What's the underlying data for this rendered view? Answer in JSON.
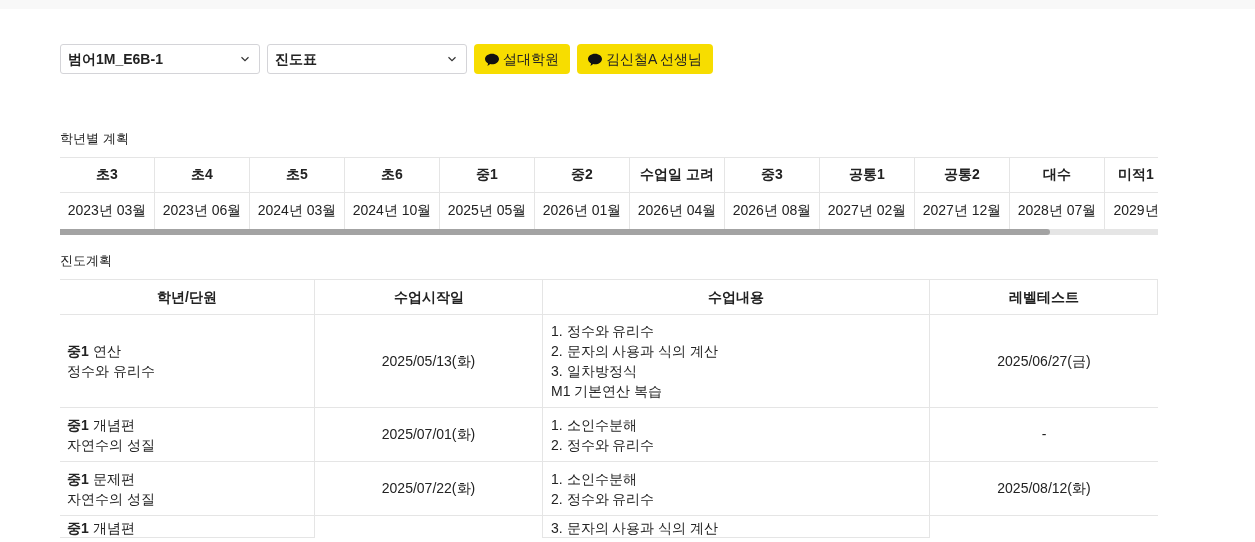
{
  "selects": [
    {
      "value": "범어1M_E6B-1"
    },
    {
      "value": "진도표"
    }
  ],
  "chat_buttons": [
    {
      "label": "설대학원"
    },
    {
      "label": "김신철A 선생님"
    }
  ],
  "grade_plan": {
    "title": "학년별 계획",
    "columns": [
      {
        "grade": "초3",
        "date": "2023년 03월"
      },
      {
        "grade": "초4",
        "date": "2023년 06월"
      },
      {
        "grade": "초5",
        "date": "2024년 03월"
      },
      {
        "grade": "초6",
        "date": "2024년 10월"
      },
      {
        "grade": "중1",
        "date": "2025년 05월"
      },
      {
        "grade": "중2",
        "date": "2026년 01월"
      },
      {
        "grade": "수업일 고려",
        "date": "2026년 04월"
      },
      {
        "grade": "중3",
        "date": "2026년 08월"
      },
      {
        "grade": "공통1",
        "date": "2027년 02월"
      },
      {
        "grade": "공통2",
        "date": "2027년 12월"
      },
      {
        "grade": "대수",
        "date": "2028년 07월"
      },
      {
        "grade": "미적1",
        "date": "2029년"
      }
    ]
  },
  "progress_plan": {
    "title": "진도계획",
    "columns": [
      "학년/단원",
      "수업시작일",
      "수업내용",
      "레벨테스트"
    ],
    "rows": [
      {
        "unit": "**중1** 연산",
        "topic": "정수와 유리수",
        "start": "2025/05/13(화)",
        "contents": [
          "1. 정수와 유리수",
          "2. 문자의 사용과 식의 계산",
          "3. 일차방정식",
          "M1 기본연산 복습"
        ],
        "test": "2025/06/27(금)"
      },
      {
        "unit": "**중1** 개념편",
        "topic": "자연수의 성질",
        "start": "2025/07/01(화)",
        "contents": [
          "1. 소인수분해",
          "2. 정수와 유리수"
        ],
        "test": "-"
      },
      {
        "unit": "**중1** 문제편",
        "topic": "자연수의 성질",
        "start": "2025/07/22(화)",
        "contents": [
          "1. 소인수분해",
          "2. 정수와 유리수"
        ],
        "test": "2025/08/12(화)"
      },
      {
        "unit": "**중1** 개념편",
        "contents": [
          "3. 문자의 사용과 식의 계산"
        ]
      }
    ]
  }
}
